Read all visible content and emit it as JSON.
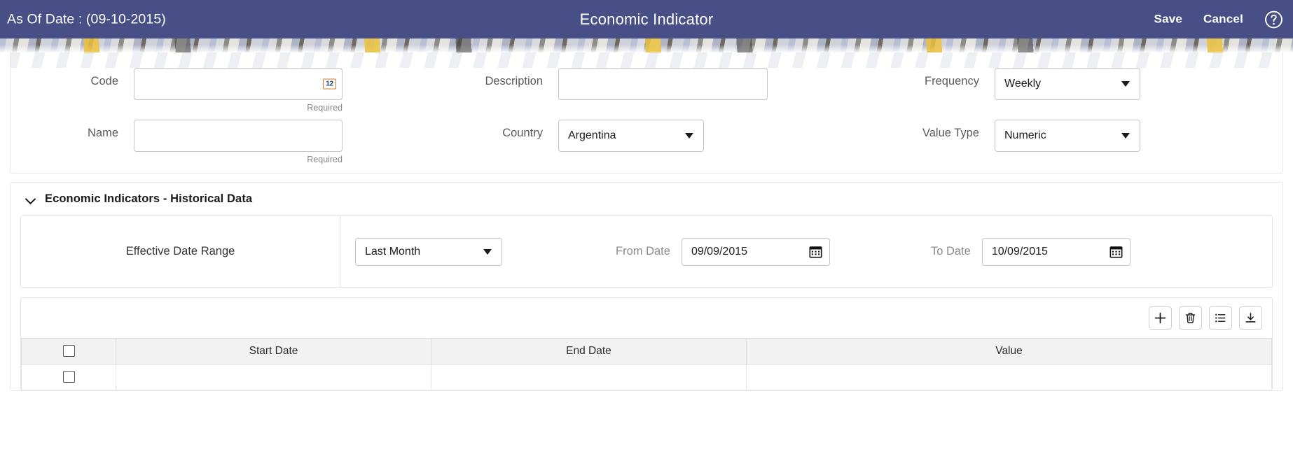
{
  "header": {
    "as_of_date_label": "As Of Date : (09-10-2015)",
    "title": "Economic Indicator",
    "save_label": "Save",
    "cancel_label": "Cancel",
    "help_icon": "help-circle-icon",
    "background_color": "#474f86"
  },
  "form": {
    "fields": {
      "code": {
        "label": "Code",
        "value": "",
        "placeholder": "",
        "hint": "Required",
        "icon": "numeric-12-icon"
      },
      "name": {
        "label": "Name",
        "value": "",
        "placeholder": "",
        "hint": "Required"
      },
      "description": {
        "label": "Description",
        "value": "",
        "placeholder": ""
      },
      "country": {
        "label": "Country",
        "value": "Argentina",
        "options": [
          "Argentina"
        ]
      },
      "frequency": {
        "label": "Frequency",
        "value": "Weekly",
        "options": [
          "Weekly"
        ]
      },
      "value_type": {
        "label": "Value Type",
        "value": "Numeric",
        "options": [
          "Numeric"
        ]
      }
    }
  },
  "section": {
    "title": "Economic Indicators - Historical Data",
    "collapse_icon": "chevron-down-icon",
    "date_range": {
      "label": "Effective Date Range",
      "range_select": {
        "value": "Last Month",
        "options": [
          "Last Month"
        ]
      },
      "from_date": {
        "label": "From Date",
        "value": "09/09/2015",
        "icon": "calendar-icon"
      },
      "to_date": {
        "label": "To Date",
        "value": "10/09/2015",
        "icon": "calendar-icon"
      }
    },
    "toolbar": {
      "buttons": [
        {
          "name": "add-row-button",
          "icon": "plus-icon"
        },
        {
          "name": "delete-row-button",
          "icon": "trash-icon"
        },
        {
          "name": "list-view-button",
          "icon": "list-icon"
        },
        {
          "name": "download-button",
          "icon": "download-icon"
        }
      ]
    },
    "table": {
      "columns": [
        "",
        "Start Date",
        "End Date",
        "Value"
      ],
      "select_all_checkbox": false,
      "rows": [
        {
          "selected": false,
          "start_date": "",
          "end_date": "",
          "value": ""
        }
      ]
    }
  }
}
